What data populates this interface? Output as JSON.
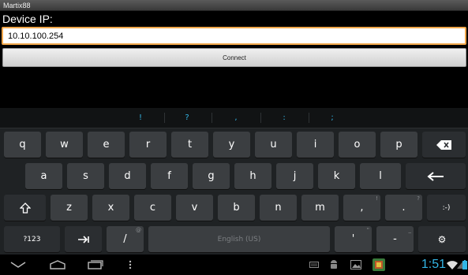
{
  "window": {
    "title": "Martix88"
  },
  "form": {
    "ip_label": "Device IP:",
    "ip_value": "10.10.100.254",
    "connect_label": "Connect"
  },
  "keyboard": {
    "suggestions": [
      "!",
      "?",
      ",",
      ":",
      ";"
    ],
    "row1": [
      "q",
      "w",
      "e",
      "r",
      "t",
      "y",
      "u",
      "i",
      "o",
      "p"
    ],
    "row2": [
      "a",
      "s",
      "d",
      "f",
      "g",
      "h",
      "j",
      "k",
      "l"
    ],
    "row3": [
      "z",
      "x",
      "c",
      "v",
      "b",
      "n",
      "m"
    ],
    "comma": ",",
    "comma_hint": "!",
    "period": ".",
    "period_hint": "?",
    "smiley": ":-)",
    "symbols_label": "?123",
    "slash": "/",
    "slash_hint": "@",
    "space_label": "English (US)",
    "apostrophe": "'",
    "apostrophe_hint": "\"",
    "dash": "-",
    "dash_hint": "_",
    "settings_glyph": "⚙"
  },
  "status": {
    "time": "1:51"
  },
  "colors": {
    "accent": "#33b5e5",
    "focus": "#f0a64a"
  }
}
